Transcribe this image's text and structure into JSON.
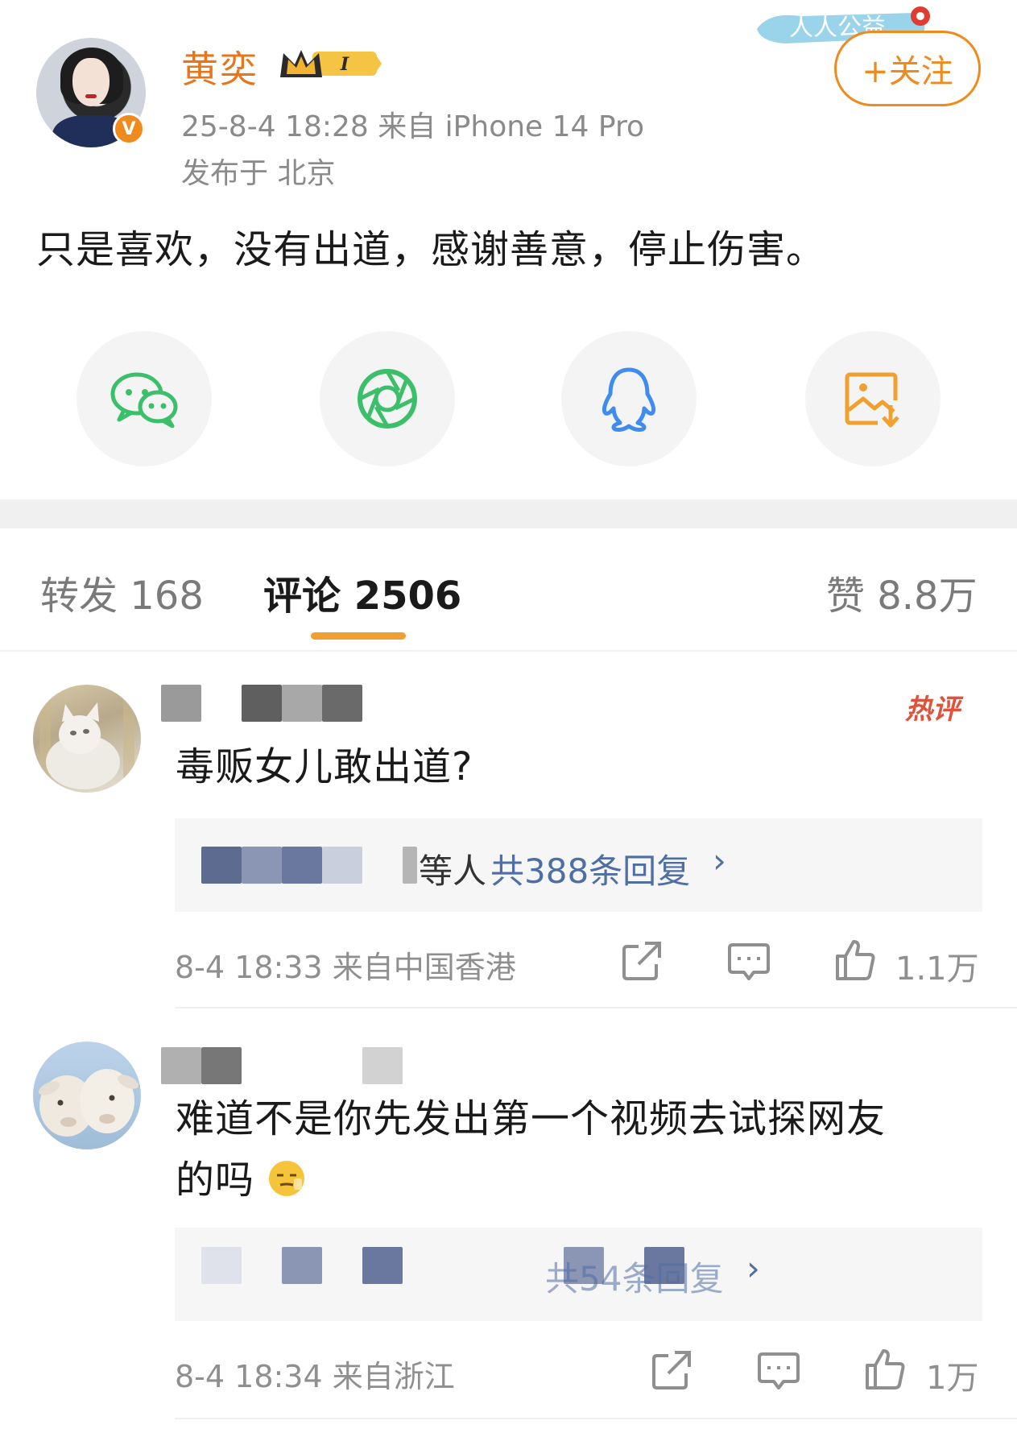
{
  "post": {
    "author": "黄奕",
    "timestamp": "25-8-4 18:28  来自 iPhone 14 Pro",
    "location": "发布于 北京",
    "follow_label": "+关注",
    "banner_text": "人人公益",
    "text": "只是喜欢，没有出道，感谢善意，停止伤害。",
    "level_badge": "I"
  },
  "share": {
    "items": [
      {
        "name": "wechat-icon"
      },
      {
        "name": "moments-icon"
      },
      {
        "name": "qq-icon"
      },
      {
        "name": "save-image-icon"
      }
    ]
  },
  "tabs": {
    "repost": "转发 168",
    "comments": "评论 2506",
    "likes": "赞 8.8万"
  },
  "comments": [
    {
      "text": "毒贩女儿敢出道?",
      "hot_tag": "热评",
      "reply_fragment": "等人",
      "reply_link": "共388条回复",
      "reply_arrow": "›",
      "meta": "8-4 18:33  来自中国香港",
      "likes": "1.1万"
    },
    {
      "text_line1": "难道不是你先发出第一个视频去试探网友",
      "text_line2": "的吗",
      "reply_link": "共54条回复",
      "reply_arrow": "›",
      "meta": "8-4 18:34  来自浙江",
      "likes": "1万"
    }
  ],
  "colors": {
    "accent_orange": "#f08a1d",
    "link_blue": "#4f6ea3",
    "hot_red": "#e0533a",
    "tab_underline": "#f0a030"
  }
}
